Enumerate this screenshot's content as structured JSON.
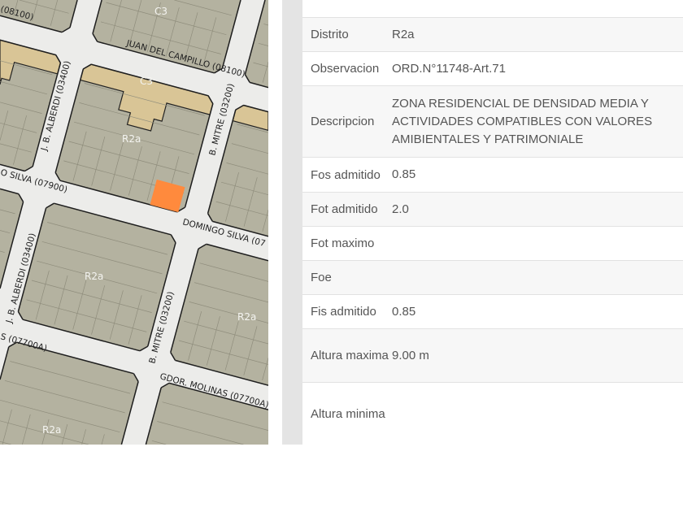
{
  "map": {
    "zones": [
      "C3",
      "C3",
      "R2a",
      "R2a",
      "R2a",
      "R2a"
    ],
    "streets": {
      "juan_del_campillo_top": "(08100)",
      "juan_del_campillo": "JUAN DEL CAMPILLO (08100)",
      "domingo_silva_left": "O SILVA (07900)",
      "domingo_silva_right": "DOMINGO SILVA (07",
      "alberdi_top": "J. B. ALBERDI (03400)",
      "alberdi_bottom": "J. B. ALBERDI (03400)",
      "mitre_top": "B. MITRE (03200)",
      "mitre_bottom": "B. MITRE (03200)",
      "molinas_left": "S (07700A)",
      "molinas_right": "GDOR. MOLINAS (07700A)"
    },
    "colors": {
      "block": "#b4b2a0",
      "commercial": "#d9c596",
      "selected_parcel": "#ff8a3d",
      "street": "#ececea"
    }
  },
  "table": {
    "rows": [
      {
        "label": "Distrito",
        "value": "R2a"
      },
      {
        "label": "Observacion",
        "value": "ORD.N°11748-Art.71"
      },
      {
        "label": "Descripcion",
        "value": "ZONA RESIDENCIAL DE DENSIDAD MEDIA Y ACTIVIDADES COMPATIBLES CON VALORES AMIBIENTALES Y PATRIMONIALE"
      },
      {
        "label": "Fos admitido",
        "value": "0.85"
      },
      {
        "label": "Fot admitido",
        "value": "2.0"
      },
      {
        "label": "Fot maximo",
        "value": ""
      },
      {
        "label": "Foe",
        "value": ""
      },
      {
        "label": "Fis admitido",
        "value": "0.85"
      },
      {
        "label": "Altura maxima",
        "value": "9.00 m"
      },
      {
        "label": "Altura minima",
        "value": ""
      }
    ]
  }
}
